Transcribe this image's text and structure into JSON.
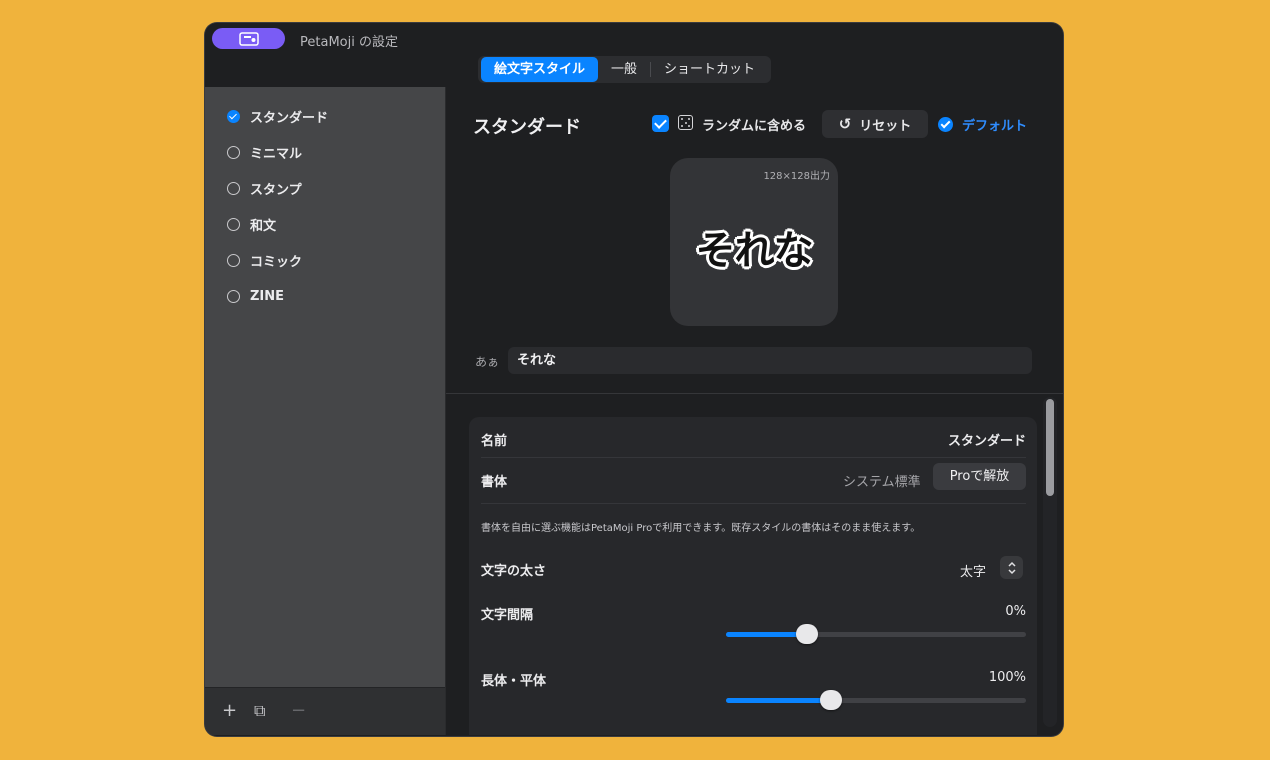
{
  "window": {
    "title": "PetaMoji の設定",
    "app_icon": "app-badge-icon"
  },
  "tabs": [
    {
      "label": "絵文字スタイル",
      "active": true
    },
    {
      "label": "一般",
      "active": false
    },
    {
      "label": "ショートカット",
      "active": false
    }
  ],
  "sidebar": {
    "items": [
      {
        "label": "スタンダード",
        "selected": true
      },
      {
        "label": "ミニマル",
        "selected": false
      },
      {
        "label": "スタンプ",
        "selected": false
      },
      {
        "label": "和文",
        "selected": false
      },
      {
        "label": "コミック",
        "selected": false
      },
      {
        "label": "ZINE",
        "selected": false
      }
    ],
    "footer": {
      "add": "+",
      "duplicate": "⧉",
      "remove": "−"
    }
  },
  "header": {
    "title": "スタンダード",
    "random_label": "ランダムに含める",
    "random_checked": true,
    "reset_label": "リセット",
    "default_label": "デフォルト"
  },
  "preview": {
    "size_label": "128×128出力",
    "text": "それな"
  },
  "text_input": {
    "prefix": "あぁ",
    "value": "それな"
  },
  "settings": {
    "name_label": "名前",
    "name_value": "スタンダード",
    "font_label": "書体",
    "font_value": "システム標準",
    "pro_button": "Proで解放",
    "note": "書体を自由に選ぶ機能はPetaMoji Proで利用できます。既存スタイルの書体はそのまま使えます。",
    "weight_label": "文字の太さ",
    "weight_value": "太字",
    "spacing_label": "文字間隔",
    "spacing_value": "0%",
    "spacing_level": 0.27,
    "aspect_label": "長体・平体",
    "aspect_value": "100%",
    "aspect_level": 0.35
  },
  "colors": {
    "accent": "#0a84ff",
    "background": "#F0B33C",
    "badge": "#7a5cf5"
  }
}
